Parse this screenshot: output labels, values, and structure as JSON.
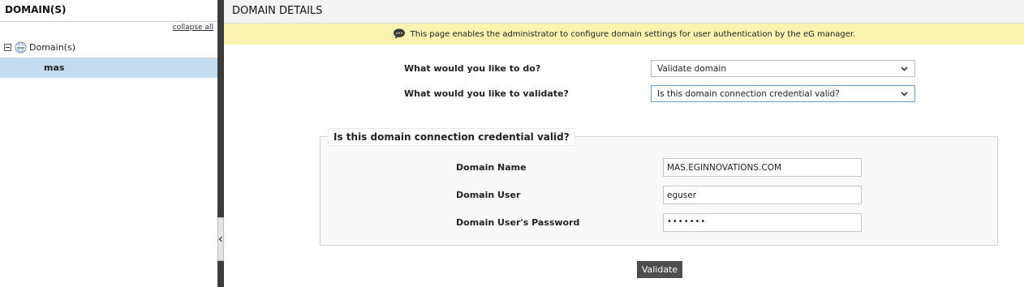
{
  "left_panel": {
    "title": "DOMAIN(S)",
    "collapse_all": "collapse all",
    "tree": {
      "root_label": "Domain(s)",
      "children": [
        "mas"
      ]
    }
  },
  "main": {
    "title": "DOMAIN DETAILS",
    "banner_text": "This page enables the administrator to configure domain settings for user authentication by the eG manager.",
    "questions": [
      {
        "label": "What would you like to do?",
        "selected": "Validate domain"
      },
      {
        "label": "What would you like to validate?",
        "selected": "Is this domain connection credential valid?"
      }
    ],
    "section": {
      "legend": "Is this domain connection credential valid?",
      "fields": [
        {
          "label": "Domain Name",
          "value": "MAS.EGINNOVATIONS.COM"
        },
        {
          "label": "Domain User",
          "value": "eguser"
        },
        {
          "label": "Domain User's Password",
          "value": "•••••••"
        }
      ]
    },
    "validate_button": "Validate"
  },
  "colors": {
    "banner_bg": "#fbf3b0",
    "selected_row": "#c4dcf0",
    "splitter": "#3c3c3c",
    "button_bg": "#4d4d4d"
  },
  "icons": {
    "tree_toggle": "minus-box-icon",
    "domain": "globe-www-icon",
    "banner": "speech-bubble-icon",
    "select_arrow": "chevron-down-icon",
    "splitter": "chevron-left-icon"
  }
}
